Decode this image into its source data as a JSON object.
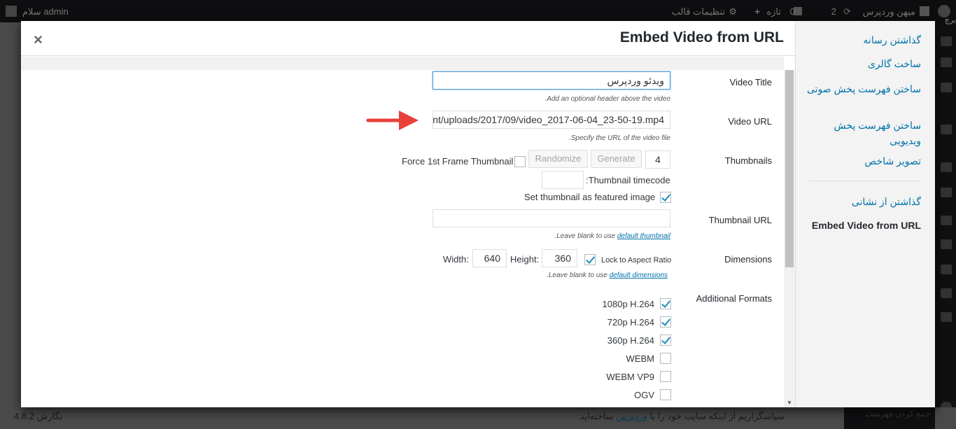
{
  "adminbar": {
    "greeting": "سلام admin",
    "site": "میهن وردپرس",
    "updates": "2",
    "comments": "0",
    "new": "تازه",
    "customize": "تنظیمات قالب"
  },
  "footer": {
    "thanks_pre": "سپاسگزاریم از اینکه سایت خود را با ",
    "thanks_link": "وردپرس",
    "thanks_post": " ساخته‌اید.",
    "version": "نگارش 4.8.2",
    "collapse": "جمع کردن فهرست"
  },
  "modal": {
    "title": "Embed Video from URL",
    "close": "×",
    "sidebar": {
      "items": [
        "گذاشتن رسانه",
        "ساخت گالری",
        "ساختن فهرست پخش صوتی",
        "ساختن فهرست پخش ویدیویی",
        "تصویر شاخص"
      ],
      "insert_from_url": "گذاشتن از نشانی",
      "active": "Embed Video from URL",
      "partial_top": "برچ"
    },
    "form": {
      "video_title": {
        "label": "Video Title",
        "value": "ویدئو وردپرس",
        "hint": "Add an optional header above the video."
      },
      "video_url": {
        "label": "Video URL",
        "value": "nt/uploads/2017/09/video_2017-06-04_23-50-19.mp4",
        "hint": "Specify the URL of the video file."
      },
      "thumbnails": {
        "label": "Thumbnails",
        "count": "4",
        "generate": "Generate",
        "randomize": "Randomize",
        "force_first": "Force 1st Frame Thumbnail",
        "force_first_checked": false,
        "timecode_label": "Thumbnail timecode:",
        "timecode_value": "",
        "featured": "Set thumbnail as featured image",
        "featured_checked": true
      },
      "thumbnail_url": {
        "label": "Thumbnail URL",
        "value": "",
        "hint_pre": "Leave blank to use ",
        "hint_link": "default thumbnail",
        "hint_post": "."
      },
      "dimensions": {
        "label": "Dimensions",
        "width_label": "Width:",
        "width": "640",
        "height_label": "Height:",
        "height": "360",
        "lock": "Lock to Aspect Ratio",
        "lock_checked": true,
        "hint_pre": "Leave blank to use ",
        "hint_link": "default dimensions",
        "hint_post": "."
      },
      "formats": {
        "label": "Additional Formats",
        "items": [
          {
            "label": "1080p H.264",
            "checked": true
          },
          {
            "label": "720p H.264",
            "checked": true
          },
          {
            "label": "360p H.264",
            "checked": true
          },
          {
            "label": "WEBM",
            "checked": false
          },
          {
            "label": "WEBM VP9",
            "checked": false
          },
          {
            "label": "OGV",
            "checked": false
          }
        ]
      }
    }
  },
  "colors": {
    "accent": "#0073aa",
    "arrow": "#e8413a"
  }
}
